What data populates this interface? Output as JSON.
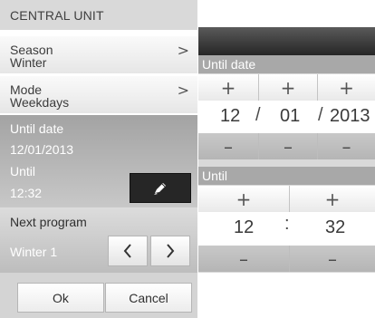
{
  "header": {
    "title": "CENTRAL UNIT"
  },
  "season": {
    "label": "Season",
    "value": "Winter",
    "chevron": "chevron-right-icon"
  },
  "mode": {
    "label": "Mode",
    "value": "Weekdays",
    "chevron": "chevron-right-icon"
  },
  "until_date": {
    "label": "Until date",
    "value": "12/01/2013"
  },
  "until_time": {
    "label": "Until",
    "value": "12:32",
    "edit_icon": "pencil-icon"
  },
  "next_program": {
    "label": "Next program",
    "value": "Winter 1",
    "prev": "‹",
    "next": "›"
  },
  "actions": {
    "ok": "Ok",
    "cancel": "Cancel"
  },
  "editor": {
    "date_label": "Until date",
    "time_label": "Until",
    "plus": "+",
    "minus": "–",
    "day": "12",
    "month": "01",
    "year": "2013",
    "date_sep": "/",
    "hour": "12",
    "minute": "32",
    "time_sep": ":"
  },
  "colors": {
    "header_bg": "#d9d9d9",
    "edit_button_bg": "#262626",
    "panel_gray": "#a8a8a8"
  }
}
